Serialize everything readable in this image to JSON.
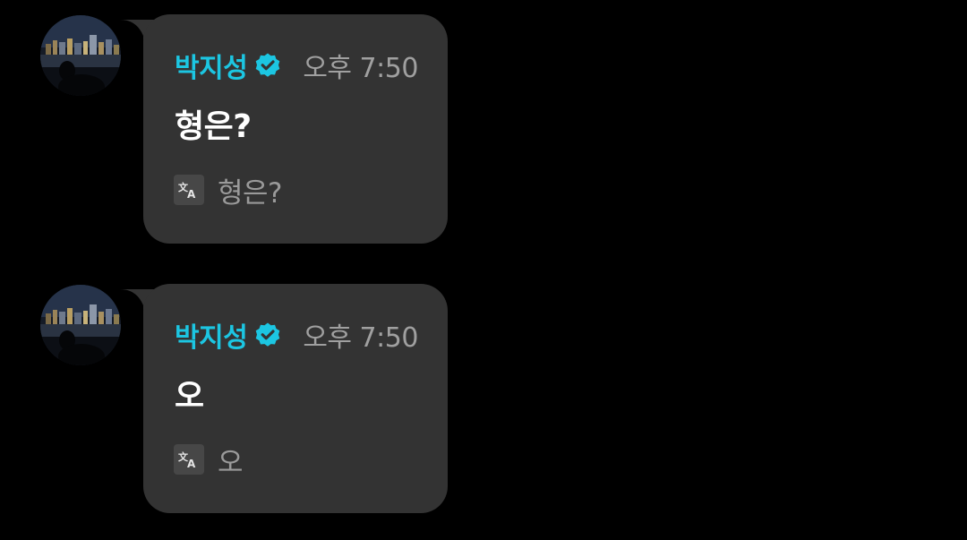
{
  "theme": {
    "background": "#000000",
    "bubble": "#333333",
    "sender_color": "#1cc6e2",
    "time_color": "#a0a0a0",
    "message_color": "#ffffff",
    "translation_color": "#9a9a9a"
  },
  "messages": [
    {
      "sender": "박지성",
      "verified_icon": "verified-badge-icon",
      "time": "오후 7:50",
      "text": "형은?",
      "translate_icon": "translate-icon",
      "translation": "형은?"
    },
    {
      "sender": "박지성",
      "verified_icon": "verified-badge-icon",
      "time": "오후 7:50",
      "text": "오",
      "translate_icon": "translate-icon",
      "translation": "오"
    }
  ]
}
